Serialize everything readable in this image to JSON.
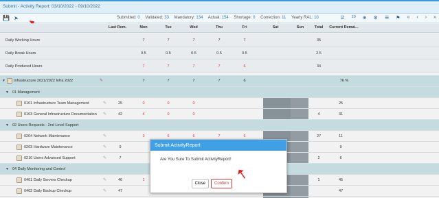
{
  "window": {
    "title": "Submit - Activity Report: 03/10/2022 - 09/10/2022"
  },
  "toolbar": {
    "save_icon": "save-icon",
    "submit_icon": "send-icon",
    "stats": {
      "submitted_label": "Submitted:",
      "submitted": "0",
      "validated_label": "Validated:",
      "validated": "33",
      "mandatory_label": "Mandatory:",
      "mandatory": "134",
      "actual_label": "Actual:",
      "actual": "154",
      "shortage_label": "Shortage:",
      "shortage": "0",
      "correction_label": "Correction:",
      "correction": "11",
      "yearly_label": "Yearly RAL:",
      "yearly": "10"
    },
    "right": {
      "zoom": "20"
    }
  },
  "grid": {
    "headers": [
      "Last Rem.",
      "Mon",
      "Tue",
      "Wed",
      "Thu",
      "Fri",
      "Sat",
      "Sun",
      "Total",
      "Current Remai..."
    ],
    "summary": [
      {
        "label": "Daily Working Hours",
        "mon": "7",
        "tue": "7",
        "wed": "7",
        "thu": "7",
        "fri": "7",
        "total": "35"
      },
      {
        "label": "Daily Break Hours",
        "mon": "0.5",
        "tue": "0.5",
        "wed": "0.5",
        "thu": "0.5",
        "fri": "0.5",
        "total": "2.5"
      },
      {
        "label": "Daily Produced Hours",
        "mon": "7",
        "tue": "7",
        "wed": "7",
        "thu": "7",
        "fri": "6",
        "total": "34"
      }
    ],
    "project": {
      "label": "Infrastructure 2021/2022 Infra 2022",
      "mon": "7",
      "tue": "7",
      "wed": "7",
      "thu": "7",
      "fri": "6",
      "percent": "76 %"
    },
    "rows": [
      {
        "type": "group",
        "label": "01 Management"
      },
      {
        "type": "task",
        "label": "0101 Infrastructure Team Management",
        "last": "25",
        "mon": "0",
        "tue": "0",
        "wed": "0",
        "thu": "",
        "fri": "",
        "total": "",
        "remain": "25"
      },
      {
        "type": "task",
        "label": "0103 General Infrastructure Documentation",
        "last": "42",
        "mon": "4",
        "tue": "0",
        "wed": "0",
        "thu": "",
        "fri": "",
        "total": "4",
        "remain": "31"
      },
      {
        "type": "group",
        "label": "02 Users Requests - 2nd Level Support"
      },
      {
        "type": "task",
        "label": "0204 Network Maintenance",
        "last": "",
        "mon": "3",
        "tue": "6",
        "wed": "6",
        "thu": "7",
        "fri": "6",
        "total": "27",
        "remain": "11"
      },
      {
        "type": "task",
        "label": "0203 Hardware Maintenance",
        "last": "9",
        "mon": "",
        "tue": "",
        "wed": "",
        "thu": "",
        "fri": "",
        "total": "",
        "remain": "9"
      },
      {
        "type": "task",
        "label": "0210 Users Advanced Support",
        "last": "7",
        "mon": "",
        "tue": "",
        "wed": "",
        "thu": "",
        "fri": "",
        "total": "2",
        "remain": "6"
      },
      {
        "type": "group",
        "label": "04 Daily Monitoring and Control"
      },
      {
        "type": "task",
        "label": "0401 Daily Servers Checkup",
        "last": "46",
        "mon": "1",
        "tue": "",
        "wed": "",
        "thu": "",
        "fri": "",
        "total": "1",
        "remain": "45"
      },
      {
        "type": "task",
        "label": "0402 Daily Backup Checkup",
        "last": "47",
        "mon": "",
        "tue": "",
        "wed": "",
        "thu": "",
        "fri": "",
        "total": "",
        "remain": "47"
      }
    ]
  },
  "modal": {
    "title": "Submit ActivityReport",
    "message": "Are You Sure To Submit ActivityReport!",
    "close_label": "Close",
    "confirm_label": "Confirm"
  }
}
